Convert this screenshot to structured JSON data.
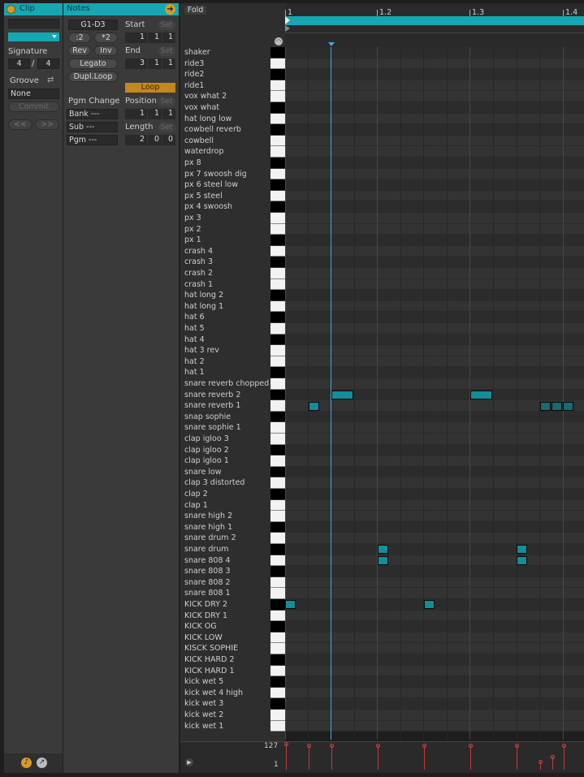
{
  "clip": {
    "title": "Clip",
    "signature_label": "Signature",
    "sig_num": "4",
    "sig_sep": "/",
    "sig_den": "4",
    "groove_label": "Groove",
    "groove_value": "None",
    "commit_label": "Commit",
    "nudge_back": "<<",
    "nudge_fwd": ">>"
  },
  "notes": {
    "title": "Notes",
    "range": "G1-D3",
    "half": ":2",
    "double": "*2",
    "rev": "Rev",
    "inv": "Inv",
    "legato": "Legato",
    "dupl": "Dupl.Loop",
    "pgm_change": "Pgm Change",
    "bank": "Bank ---",
    "sub": "Sub ---",
    "pgm": "Pgm ---"
  },
  "loop": {
    "start_label": "Start",
    "end_label": "End",
    "set": "Set",
    "start": [
      "1",
      "1",
      "1"
    ],
    "end": [
      "3",
      "1",
      "1"
    ],
    "loop_label": "Loop",
    "position_label": "Position",
    "position": [
      "1",
      "1",
      "1"
    ],
    "length_label": "Length",
    "length": [
      "2",
      "0",
      "0"
    ]
  },
  "editor": {
    "fold": "Fold",
    "ruler": [
      "1",
      "1.2",
      "1.3",
      "1.4"
    ],
    "vel_max": "127",
    "vel_min": "1"
  },
  "rows": [
    {
      "name": "shaker",
      "key": "b"
    },
    {
      "name": "ride3",
      "key": "w"
    },
    {
      "name": "ride2",
      "key": "b"
    },
    {
      "name": "ride1",
      "key": "w"
    },
    {
      "name": "vox what 2",
      "key": "w"
    },
    {
      "name": "vox what",
      "key": "b"
    },
    {
      "name": "hat long low",
      "key": "w"
    },
    {
      "name": "cowbell reverb",
      "key": "b"
    },
    {
      "name": "cowbell",
      "key": "w"
    },
    {
      "name": "waterdrop",
      "key": "w"
    },
    {
      "name": "px 8",
      "key": "b"
    },
    {
      "name": "px 7 swoosh dig",
      "key": "w"
    },
    {
      "name": "px 6 steel low",
      "key": "b"
    },
    {
      "name": "px 5 steel",
      "key": "w"
    },
    {
      "name": "px 4 swoosh",
      "key": "b"
    },
    {
      "name": "px 3",
      "key": "w"
    },
    {
      "name": "px 2",
      "key": "w"
    },
    {
      "name": "px 1",
      "key": "b"
    },
    {
      "name": "crash 4",
      "key": "w"
    },
    {
      "name": "crash 3",
      "key": "b"
    },
    {
      "name": "crash 2",
      "key": "w"
    },
    {
      "name": "crash 1",
      "key": "w"
    },
    {
      "name": "hat long 2",
      "key": "b"
    },
    {
      "name": "hat long 1",
      "key": "w"
    },
    {
      "name": "hat 6",
      "key": "b"
    },
    {
      "name": "hat 5",
      "key": "w"
    },
    {
      "name": "hat 4",
      "key": "b"
    },
    {
      "name": "hat 3 rev",
      "key": "w"
    },
    {
      "name": "hat 2",
      "key": "w"
    },
    {
      "name": "hat 1",
      "key": "b"
    },
    {
      "name": "snare reverb chopped",
      "key": "w"
    },
    {
      "name": "snare reverb 2",
      "key": "b"
    },
    {
      "name": "snare reverb 1",
      "key": "w"
    },
    {
      "name": "snap sophie",
      "key": "b"
    },
    {
      "name": "snare sophie 1",
      "key": "w"
    },
    {
      "name": "clap igloo 3",
      "key": "w"
    },
    {
      "name": "clap igloo 2",
      "key": "b"
    },
    {
      "name": "clap igloo 1",
      "key": "w"
    },
    {
      "name": "snare low",
      "key": "b"
    },
    {
      "name": "clap 3 distorted",
      "key": "w"
    },
    {
      "name": "clap 2",
      "key": "b"
    },
    {
      "name": "clap 1",
      "key": "w"
    },
    {
      "name": "snare high 2",
      "key": "w"
    },
    {
      "name": "snare high 1",
      "key": "b"
    },
    {
      "name": "snare drum 2",
      "key": "w"
    },
    {
      "name": "snare drum",
      "key": "b"
    },
    {
      "name": "snare 808 4",
      "key": "w"
    },
    {
      "name": "snare 808 3",
      "key": "b"
    },
    {
      "name": "snare 808 2",
      "key": "w"
    },
    {
      "name": "snare 808 1",
      "key": "w"
    },
    {
      "name": "KICK DRY 2",
      "key": "b"
    },
    {
      "name": "KICK DRY 1",
      "key": "w"
    },
    {
      "name": "KICK OG",
      "key": "b"
    },
    {
      "name": "KICK LOW",
      "key": "w"
    },
    {
      "name": "KISCK SOPHIE",
      "key": "w"
    },
    {
      "name": "KICK HARD 2",
      "key": "b"
    },
    {
      "name": "KICK HARD 1",
      "key": "w"
    },
    {
      "name": "kick wet 5",
      "key": "b"
    },
    {
      "name": "kick wet 4 high",
      "key": "w"
    },
    {
      "name": "kick wet 3",
      "key": "b"
    },
    {
      "name": "kick wet 2",
      "key": "w"
    },
    {
      "name": "kick wet 1",
      "key": "w"
    }
  ],
  "colors": {
    "accent": "#16a7b3",
    "note": "#128e9a",
    "loop": "#c4861e",
    "velocity": "#c23a3a",
    "playhead": "#4aa8d8"
  }
}
